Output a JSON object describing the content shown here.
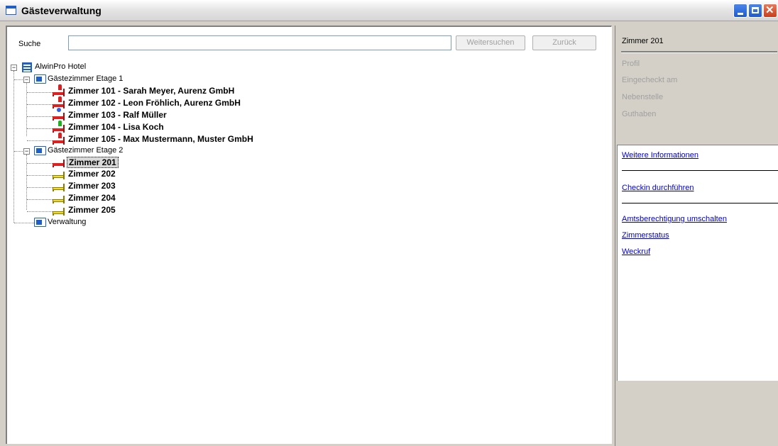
{
  "window": {
    "title": "Gästeverwaltung"
  },
  "search": {
    "label": "Suche",
    "value": "",
    "next_button": "Weitersuchen",
    "back_button": "Zurück"
  },
  "tree": {
    "root": "AlwinPro Hotel",
    "groups": [
      {
        "label": "Gästezimmer Etage 1",
        "rooms": [
          {
            "label": "Zimmer 101 - Sarah Meyer, Aurenz GmbH",
            "bed": "red",
            "status": "red"
          },
          {
            "label": "Zimmer 102 - Leon Fröhlich, Aurenz GmbH",
            "bed": "red",
            "status": "red"
          },
          {
            "label": "Zimmer 103 - Ralf Müller",
            "bed": "red",
            "status": "blue"
          },
          {
            "label": "Zimmer 104 - Lisa Koch",
            "bed": "red",
            "status": "green"
          },
          {
            "label": "Zimmer 105 - Max Mustermann, Muster GmbH",
            "bed": "red",
            "status": "red"
          }
        ]
      },
      {
        "label": "Gästezimmer Etage 2",
        "rooms": [
          {
            "label": "Zimmer 201",
            "bed": "red",
            "selected": true
          },
          {
            "label": "Zimmer 202",
            "bed": "yellow"
          },
          {
            "label": "Zimmer 203",
            "bed": "yellow"
          },
          {
            "label": "Zimmer 204",
            "bed": "yellow"
          },
          {
            "label": "Zimmer 205",
            "bed": "yellow"
          }
        ]
      },
      {
        "label": "Verwaltung",
        "rooms": []
      }
    ]
  },
  "details": {
    "title": "Zimmer 201",
    "fields": [
      "Profil",
      "Eingecheckt am",
      "Nebenstelle",
      "Guthaben"
    ],
    "links": [
      "Weitere Informationen",
      "Checkin durchführen",
      "Amtsberechtigung umschalten",
      "Zimmerstatus",
      "Weckruf"
    ]
  },
  "colors": {
    "link": "#0000cc",
    "titlebar_accent": "#1e5fc8",
    "disabled_text": "#a0a0a0"
  }
}
